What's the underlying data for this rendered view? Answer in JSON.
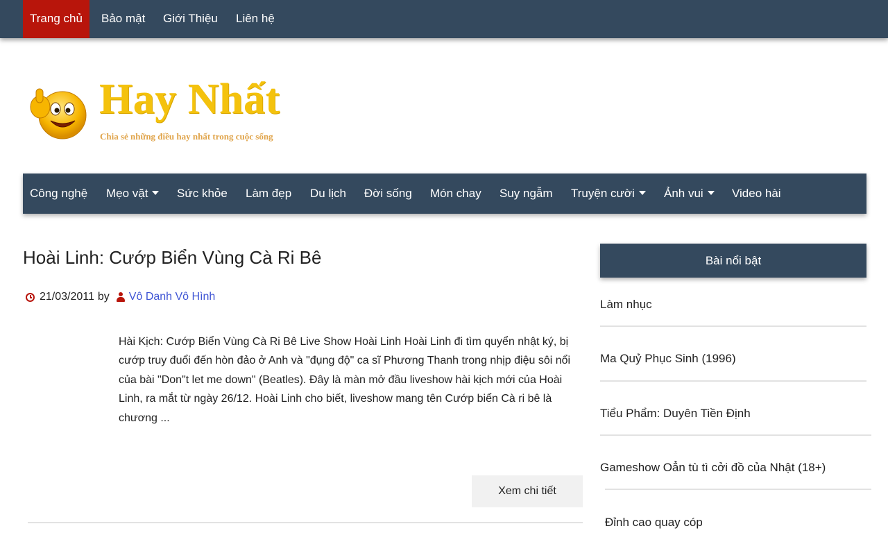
{
  "top_nav": {
    "items": [
      {
        "label": "Trang chủ",
        "active": true
      },
      {
        "label": "Bảo mật"
      },
      {
        "label": "Giới Thiệu"
      },
      {
        "label": "Liên hệ"
      }
    ]
  },
  "logo": {
    "title": "Hay Nhất",
    "tagline": "Chia sẻ những điều hay nhất trong cuộc sống"
  },
  "category_nav": {
    "items": [
      {
        "label": "Công nghệ"
      },
      {
        "label": "Mẹo vặt",
        "dropdown": true
      },
      {
        "label": "Sức khỏe"
      },
      {
        "label": "Làm đẹp"
      },
      {
        "label": "Du lịch"
      },
      {
        "label": "Đời sống"
      },
      {
        "label": "Món chay"
      },
      {
        "label": "Suy ngẫm"
      },
      {
        "label": "Truyện cười",
        "dropdown": true
      },
      {
        "label": "Ảnh vui",
        "dropdown": true
      },
      {
        "label": "Video hài"
      }
    ]
  },
  "article": {
    "title": "Hoài Linh: Cướp Biển Vùng Cà Ri Bê",
    "date": "21/03/2011",
    "by": "by",
    "author": "Vô Danh Vô Hình",
    "excerpt": "Hài Kịch: Cướp Biển Vùng Cà Ri Bê Live Show Hoài Linh Hoài Linh đi tìm quyển nhật ký, bị cướp truy đuổi đến hòn đảo ở Anh và \"đụng độ\" ca sĩ Phương Thanh trong nhịp điệu sôi nổi của bài \"Don\"t let me down\" (Beatles). Đây là màn mở đầu liveshow hài kịch mới của Hoài Linh, ra mắt từ ngày 26/12. Hoài Linh cho biết, liveshow mang tên Cướp biển Cà ri bê là chương ...",
    "read_more": "Xem chi tiết"
  },
  "sidebar": {
    "widget_title": "Bài nổi bật",
    "items": [
      {
        "label": "Làm nhục"
      },
      {
        "label": "Ma Quỷ Phục Sinh (1996)"
      },
      {
        "label": "Tiểu Phẩm: Duyên Tiền Định"
      },
      {
        "label": "Gameshow Oẳn tù tì cởi đồ của Nhật (18+)"
      },
      {
        "label": "Đỉnh cao quay cóp"
      }
    ]
  },
  "colors": {
    "nav_bg": "#34495e",
    "active_red": "#b8150b",
    "logo_yellow": "#f4c20d",
    "author_link": "#3e54d4"
  }
}
